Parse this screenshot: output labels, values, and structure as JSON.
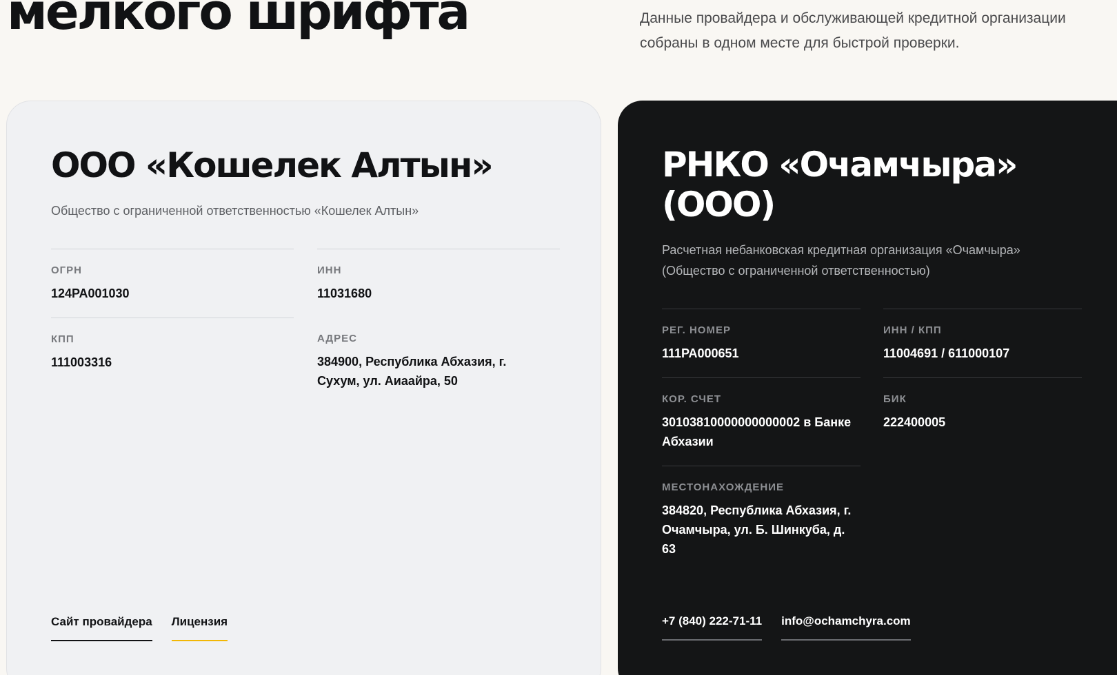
{
  "hero": {
    "title": "мелкого шрифта",
    "lead": "Данные провайдера и обслуживающей кредитной организации собраны в одном месте для быстрой проверки."
  },
  "provider": {
    "name": "ООО «Кошелек Алтын»",
    "description": "Общество с ограниченной ответственностью «Кошелек Алтын»",
    "fields": {
      "ogrn": {
        "label": "ОГРН",
        "value": "124РА001030"
      },
      "inn": {
        "label": "ИНН",
        "value": "11031680"
      },
      "kpp": {
        "label": "КПП",
        "value": "111003316"
      },
      "address": {
        "label": "АДРЕС",
        "value": "384900, Республика Абхазия, г. Сухум, ул. Аиаайра, 50"
      }
    },
    "links": {
      "site": "Сайт провайдера",
      "license": "Лицензия"
    }
  },
  "bank": {
    "name": "РНКО «Очамчыра» (ООО)",
    "description": "Расчетная небанковская кредитная организация «Очамчыра» (Общество с ограниченной ответственностью)",
    "fields": {
      "reg": {
        "label": "РЕГ. НОМЕР",
        "value": "111РА000651"
      },
      "inn_kpp": {
        "label": "ИНН / КПП",
        "value": "11004691 / 611000107"
      },
      "kor": {
        "label": "КОР. СЧЕТ",
        "value": "30103810000000000002 в Банке Абхазии"
      },
      "bik": {
        "label": "БИК",
        "value": "222400005"
      },
      "location": {
        "label": "МЕСТОНАХОЖДЕНИЕ",
        "value": "384820, Республика Абхазия, г. Очамчыра, ул. Б. Шинкуба, д. 63"
      }
    },
    "links": {
      "phone": "+7 (840) 222-71-11",
      "email": "info@ochamchyra.com"
    }
  },
  "colors": {
    "accent": "#f2b705",
    "dark_card": "#141516",
    "light_card": "#f0f1f3"
  }
}
